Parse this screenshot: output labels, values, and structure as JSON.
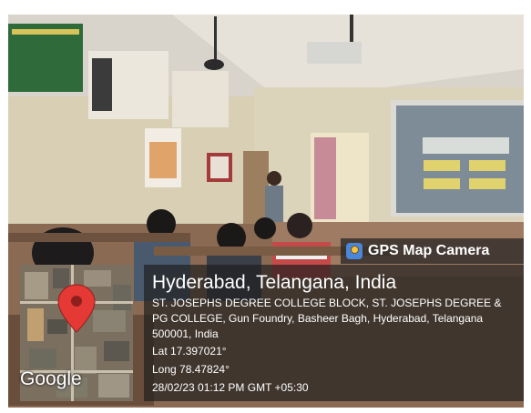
{
  "overlay": {
    "brand": "GPS Map Camera",
    "brand_icon": "gps-map-camera-icon",
    "place": "Hyderabad, Telangana, India",
    "address": "ST. JOSEPHS DEGREE COLLEGE BLOCK, ST. JOSEPHS DEGREE & PG COLLEGE, Gun Foundry, Basheer Bagh, Hyderabad, Telangana 500001, India",
    "latitude": "Lat 17.397021°",
    "longitude": "Long 78.47824°",
    "timestamp": "28/02/23 01:12 PM GMT +05:30"
  },
  "map": {
    "attribution": "Google",
    "pin_icon": "map-pin-icon",
    "pin_color": "#e53935"
  }
}
